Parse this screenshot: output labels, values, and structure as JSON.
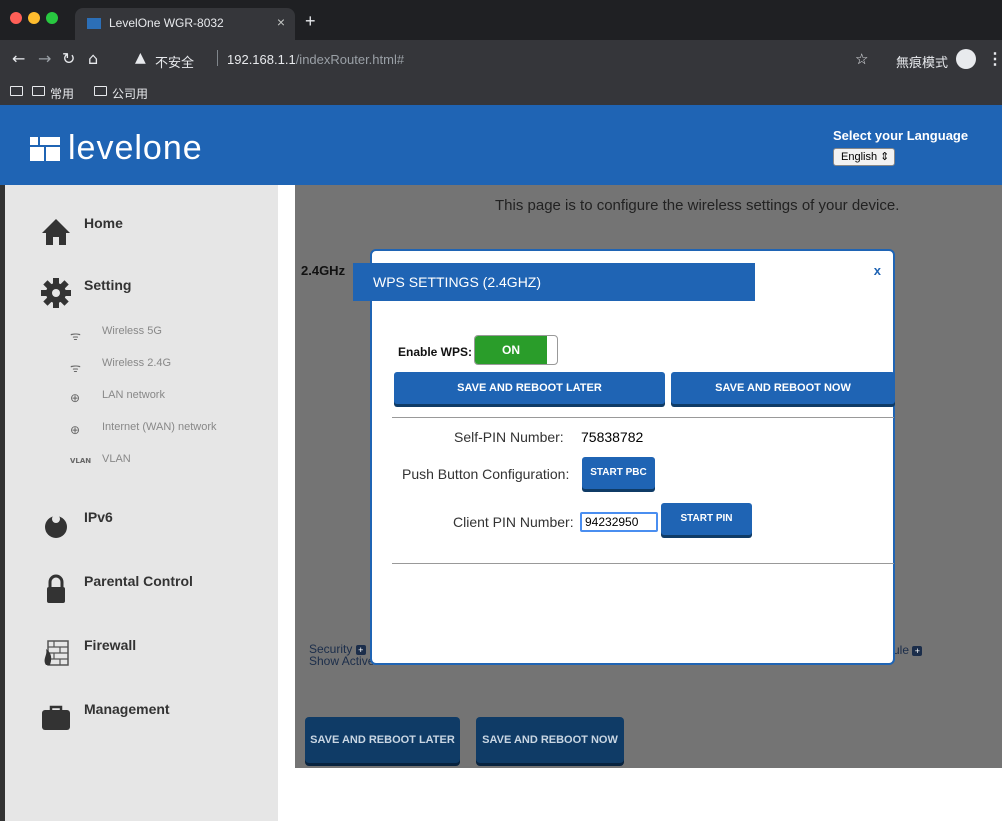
{
  "browser": {
    "tab_title": "LevelOne WGR-8032",
    "tab_close": "×",
    "new_tab": "+",
    "insecure_label": "不安全",
    "url_host": "192.168.1.1",
    "url_path": "/indexRouter.html#",
    "incognito_label": "無痕模式",
    "bookmarks": [
      "常用",
      "公司用"
    ],
    "colors": {
      "tab_active": "#35363a",
      "toolbar": "#35363a",
      "traffic": [
        "#ff5f57",
        "#febc2e",
        "#28c840"
      ]
    }
  },
  "header": {
    "logo_text": "levelone",
    "language_label": "Select your Language",
    "language_selected": "English",
    "color": "#1f64b4"
  },
  "sidebar": {
    "items": [
      {
        "label": "Home",
        "icon": "home-icon"
      },
      {
        "label": "Setting",
        "icon": "gear-icon"
      },
      {
        "label": "IPv6",
        "icon": "ipv6-icon"
      },
      {
        "label": "Parental Control",
        "icon": "lock-icon"
      },
      {
        "label": "Firewall",
        "icon": "firewall-icon"
      },
      {
        "label": "Management",
        "icon": "briefcase-icon"
      }
    ],
    "sub_items": [
      {
        "label": "Wireless 5G",
        "icon": "wifi-icon"
      },
      {
        "label": "Wireless 2.4G",
        "icon": "wifi-icon"
      },
      {
        "label": "LAN network",
        "icon": "globe-icon"
      },
      {
        "label": "Internet (WAN) network",
        "icon": "globe-icon"
      },
      {
        "label": "VLAN",
        "icon": "vlan-icon"
      }
    ]
  },
  "content": {
    "description": "This page is to configure the wireless settings of your device.",
    "band_tab": "2.4GHz",
    "link_security": "Security",
    "link_show_clients": "Show Active Clients",
    "link_schedule": "ule",
    "save_later": "SAVE AND REBOOT LATER",
    "save_now": "SAVE AND REBOOT NOW"
  },
  "modal": {
    "title": "WPS SETTINGS (2.4GHZ)",
    "close": "x",
    "enable_label": "Enable WPS:",
    "toggle_state": "ON",
    "save_later": "SAVE AND REBOOT LATER",
    "save_now": "SAVE AND REBOOT NOW",
    "self_pin_label": "Self-PIN Number:",
    "self_pin_value": "75838782",
    "pbc_label": "Push Button Configuration:",
    "pbc_button": "START PBC",
    "client_pin_label": "Client PIN Number:",
    "client_pin_value": "94232950",
    "pin_button": "START PIN",
    "colors": {
      "accent": "#1f64b4",
      "toggle_on": "#2a9d2a"
    }
  }
}
